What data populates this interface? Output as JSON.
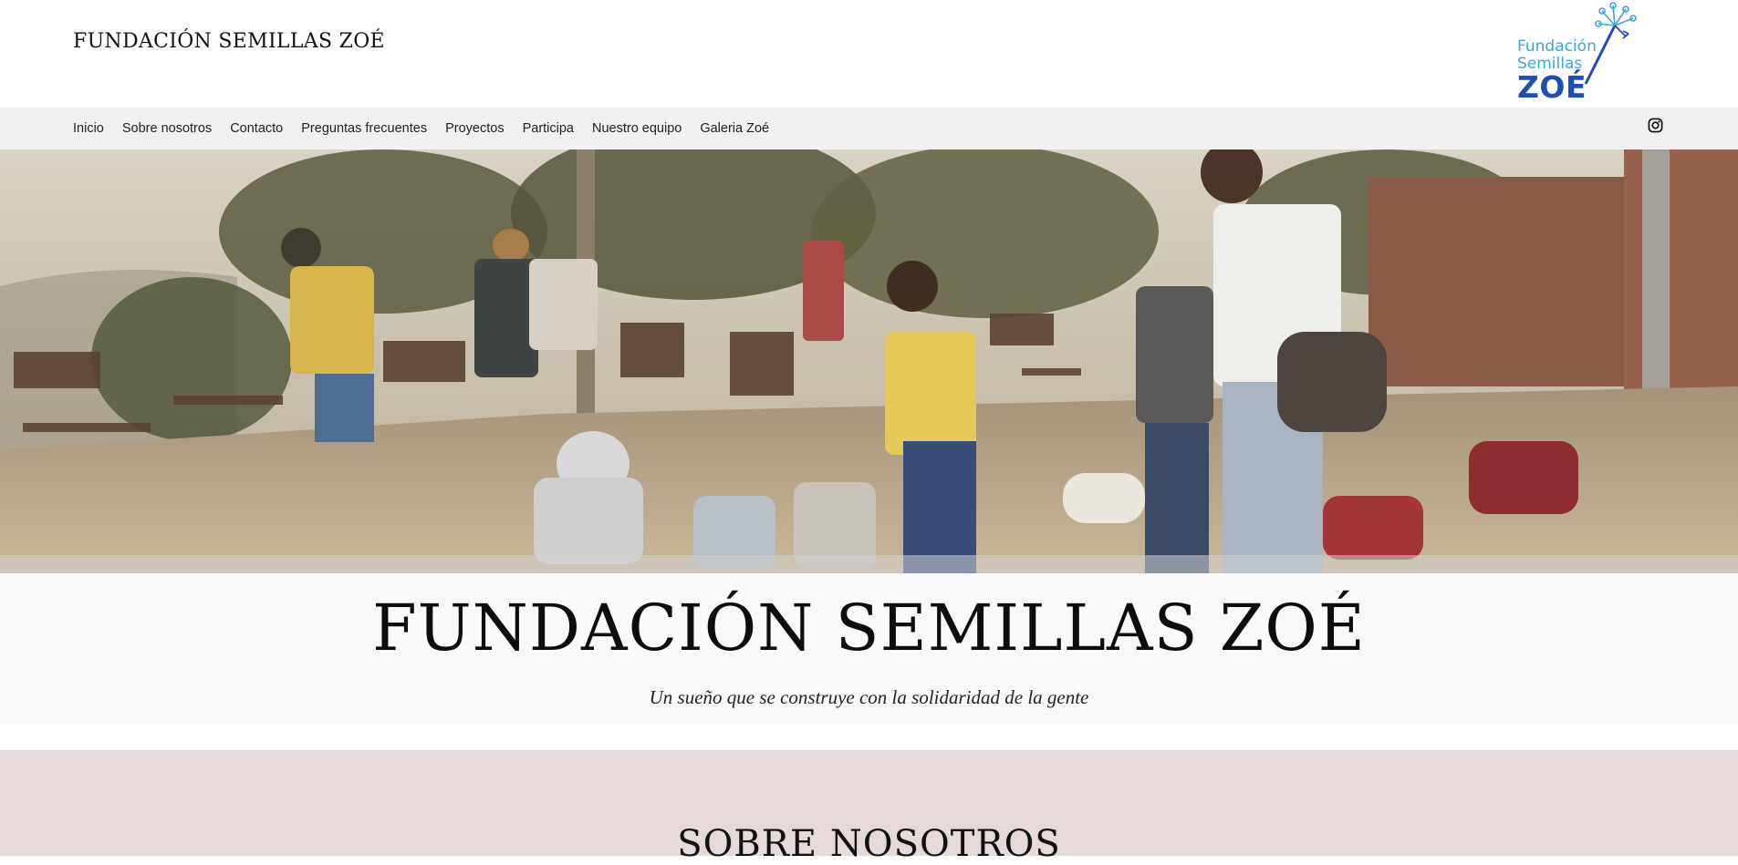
{
  "header": {
    "site_title": "FUNDACIÓN SEMILLAS ZOÉ",
    "logo": {
      "line1": "Fundación",
      "line2": "Semillas",
      "line3": "ZOÉ"
    }
  },
  "nav": {
    "items": [
      {
        "label": "Inicio"
      },
      {
        "label": "Sobre nosotros"
      },
      {
        "label": "Contacto"
      },
      {
        "label": "Preguntas frecuentes"
      },
      {
        "label": "Proyectos"
      },
      {
        "label": "Participa"
      },
      {
        "label": "Nuestro equipo"
      },
      {
        "label": "Galeria Zoé"
      }
    ],
    "social_icon": "instagram-icon"
  },
  "hero": {
    "image": "children-outdoor-classroom-photo",
    "title": "FUNDACIÓN SEMILLAS ZOÉ",
    "subtitle": "Un sueño que se construye con la solidaridad de la gente"
  },
  "about": {
    "title": "SOBRE NOSOTROS"
  },
  "colors": {
    "logo_light_blue": "#3aa6dd",
    "logo_dark_blue": "#1e4fb3",
    "nav_background": "#f1f1f1",
    "about_background": "#e6d9d9"
  }
}
